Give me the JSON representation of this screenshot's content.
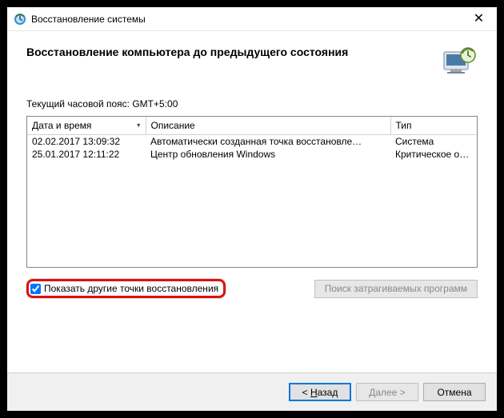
{
  "window": {
    "title": "Восстановление системы"
  },
  "page": {
    "heading": "Восстановление компьютера до предыдущего состояния",
    "timezone_label": "Текущий часовой пояс: GMT+5:00"
  },
  "columns": {
    "date": "Дата и время",
    "desc": "Описание",
    "type": "Тип"
  },
  "rows": [
    {
      "date": "02.02.2017 13:09:32",
      "desc": "Автоматически созданная точка восстановле…",
      "type": "Система"
    },
    {
      "date": "25.01.2017 12:11:22",
      "desc": "Центр обновления Windows",
      "type": "Критическое о…"
    }
  ],
  "options": {
    "show_more_label": "Показать другие точки восстановления",
    "show_more_checked": true,
    "scan_affected_label": "Поиск затрагиваемых программ"
  },
  "buttons": {
    "back_prefix": "< ",
    "back_mnemonic": "Н",
    "back_suffix": "азад",
    "next_prefix": "",
    "next_mnemonic": "Д",
    "next_suffix": "алее >",
    "cancel": "Отмена"
  }
}
